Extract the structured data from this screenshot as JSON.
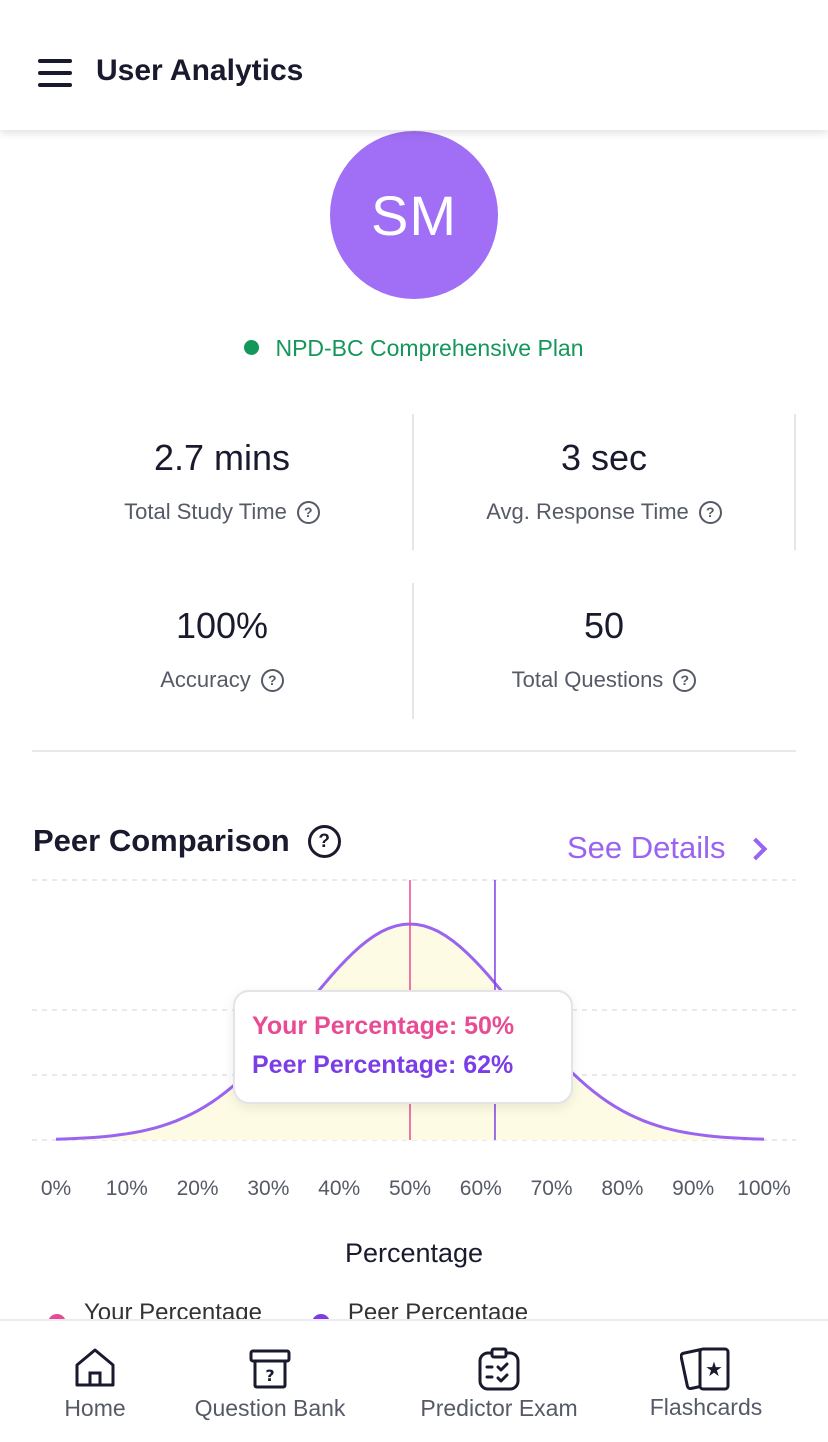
{
  "header": {
    "title": "User Analytics"
  },
  "avatar": {
    "initials": "SM",
    "color": "#a06ff5"
  },
  "plan": {
    "name": "NPD-BC Comprehensive Plan",
    "status_color": "#14975a"
  },
  "stats": [
    {
      "value": "2.7 mins",
      "label": "Total Study Time"
    },
    {
      "value": "3 sec",
      "label": "Avg. Response Time"
    },
    {
      "value": "100%",
      "label": "Accuracy"
    },
    {
      "value": "50",
      "label": "Total Questions"
    }
  ],
  "peer": {
    "title": "Peer Comparison",
    "see_details": "See Details",
    "tooltip": {
      "your": "Your Percentage: 50%",
      "peer": "Peer Percentage: 62%"
    },
    "legend": [
      "Your Percentage",
      "Peer Percentage"
    ]
  },
  "chart_data": {
    "type": "area",
    "xlabel": "Percentage",
    "x_ticks": [
      "0%",
      "10%",
      "20%",
      "30%",
      "40%",
      "50%",
      "60%",
      "70%",
      "80%",
      "90%",
      "100%"
    ],
    "xlim": [
      0,
      100
    ],
    "distribution": {
      "mean": 50,
      "std": 15
    },
    "markers": [
      {
        "name": "Your Percentage",
        "x": 50,
        "color": "#e84b93"
      },
      {
        "name": "Peer Percentage",
        "x": 62,
        "color": "#7b3ee6"
      }
    ],
    "curve_color": "#9a63f0",
    "fill_color": "#fdfbe3",
    "grid": true
  },
  "nav": [
    {
      "label": "Home",
      "icon": "home-icon"
    },
    {
      "label": "Question Bank",
      "icon": "question-box-icon"
    },
    {
      "label": "Predictor Exam",
      "icon": "clipboard-check-icon"
    },
    {
      "label": "Flashcards",
      "icon": "flashcards-star-icon"
    }
  ]
}
